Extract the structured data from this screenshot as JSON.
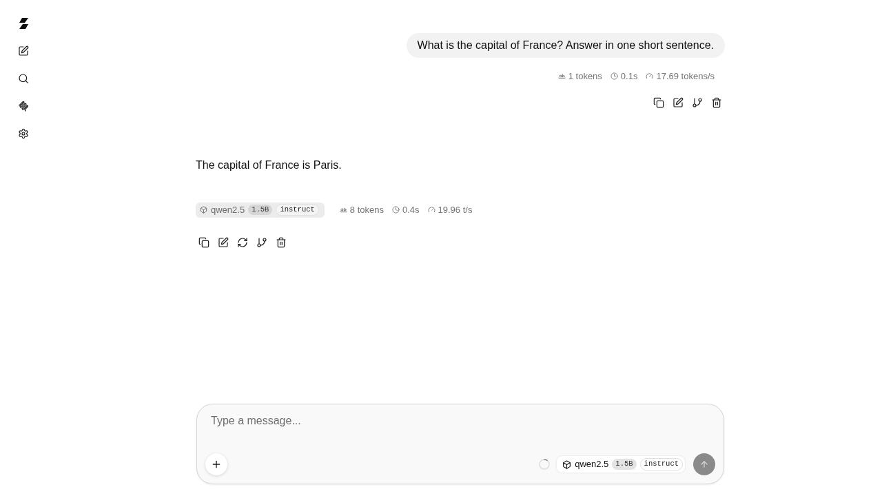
{
  "messages": [
    {
      "kind": "user",
      "text": "What is the capital of France? Answer in one short sentence.",
      "stats": [
        {
          "kind": "tokens",
          "text": "1 tokens"
        },
        {
          "kind": "time",
          "text": "0.1s"
        },
        {
          "kind": "speed",
          "text": "17.69 tokens/s"
        }
      ],
      "actions": [
        {
          "kind": "copy"
        },
        {
          "kind": "edit"
        },
        {
          "kind": "branch"
        },
        {
          "kind": "delete"
        }
      ]
    },
    {
      "kind": "assistant",
      "text": "The capital of France is Paris.",
      "model": {
        "name": "qwen2.5",
        "size": "1.5B",
        "variant": "instruct"
      },
      "stats": [
        {
          "kind": "tokens",
          "text": "8 tokens"
        },
        {
          "kind": "time",
          "text": "0.4s"
        },
        {
          "kind": "speed",
          "text": "19.96 t/s"
        }
      ],
      "actions": [
        {
          "kind": "copy"
        },
        {
          "kind": "edit"
        },
        {
          "kind": "regenerate"
        },
        {
          "kind": "branch"
        },
        {
          "kind": "delete"
        }
      ]
    }
  ],
  "composer": {
    "placeholder": "Type a message...",
    "model": {
      "name": "qwen2.5",
      "size": "1.5B",
      "variant": "instruct"
    },
    "send_disabled": true
  }
}
